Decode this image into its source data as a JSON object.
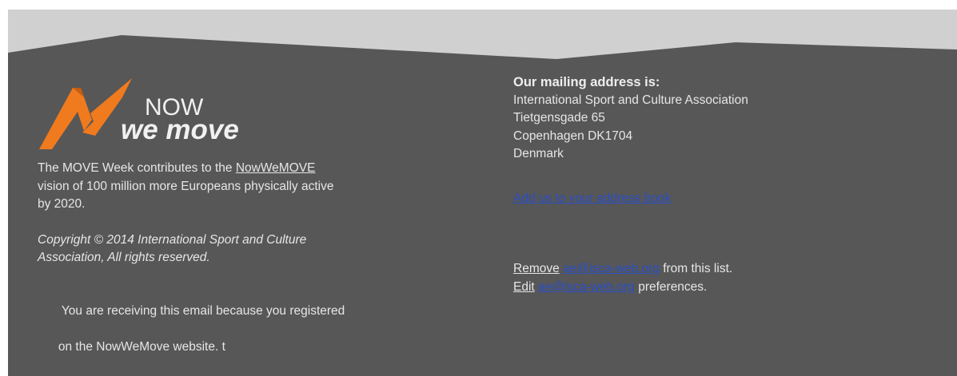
{
  "logo": {
    "text_line1": "NOW",
    "text_line2": "we move",
    "accent_orange": "#f07a1e",
    "dark_orange": "#c85d12"
  },
  "left": {
    "vision_prefix": "The MOVE Week contributes to the ",
    "vision_link": "NowWeMOVE",
    "vision_line2": "vision of 100 million more Europeans physically active",
    "vision_line3": "by 2020.",
    "copyright_line1": "Copyright © 2014 International Sport and Culture",
    "copyright_line2": "Association, All rights reserved.",
    "receiving_line1": " You are receiving this email because you registered",
    "receiving_line2": "on the NowWeMove website. t"
  },
  "right": {
    "heading": "Our mailing address is:",
    "address_lines": [
      "International Sport and Culture Association",
      "Tietgensgade 65",
      "Copenhagen DK1704",
      "Denmark"
    ],
    "add_address_book": "Add us to your address book",
    "remove_label": "Remove",
    "remove_email": "ae@isca-web.org",
    "remove_suffix": " from this list.",
    "edit_label": "Edit",
    "edit_email": "ae@isca-web.org",
    "edit_suffix": " preferences."
  },
  "colors": {
    "footer_bg": "#575757",
    "top_band": "#d0d0d0",
    "link_blue": "#2a4fc6",
    "text": "#e6e6e6"
  }
}
